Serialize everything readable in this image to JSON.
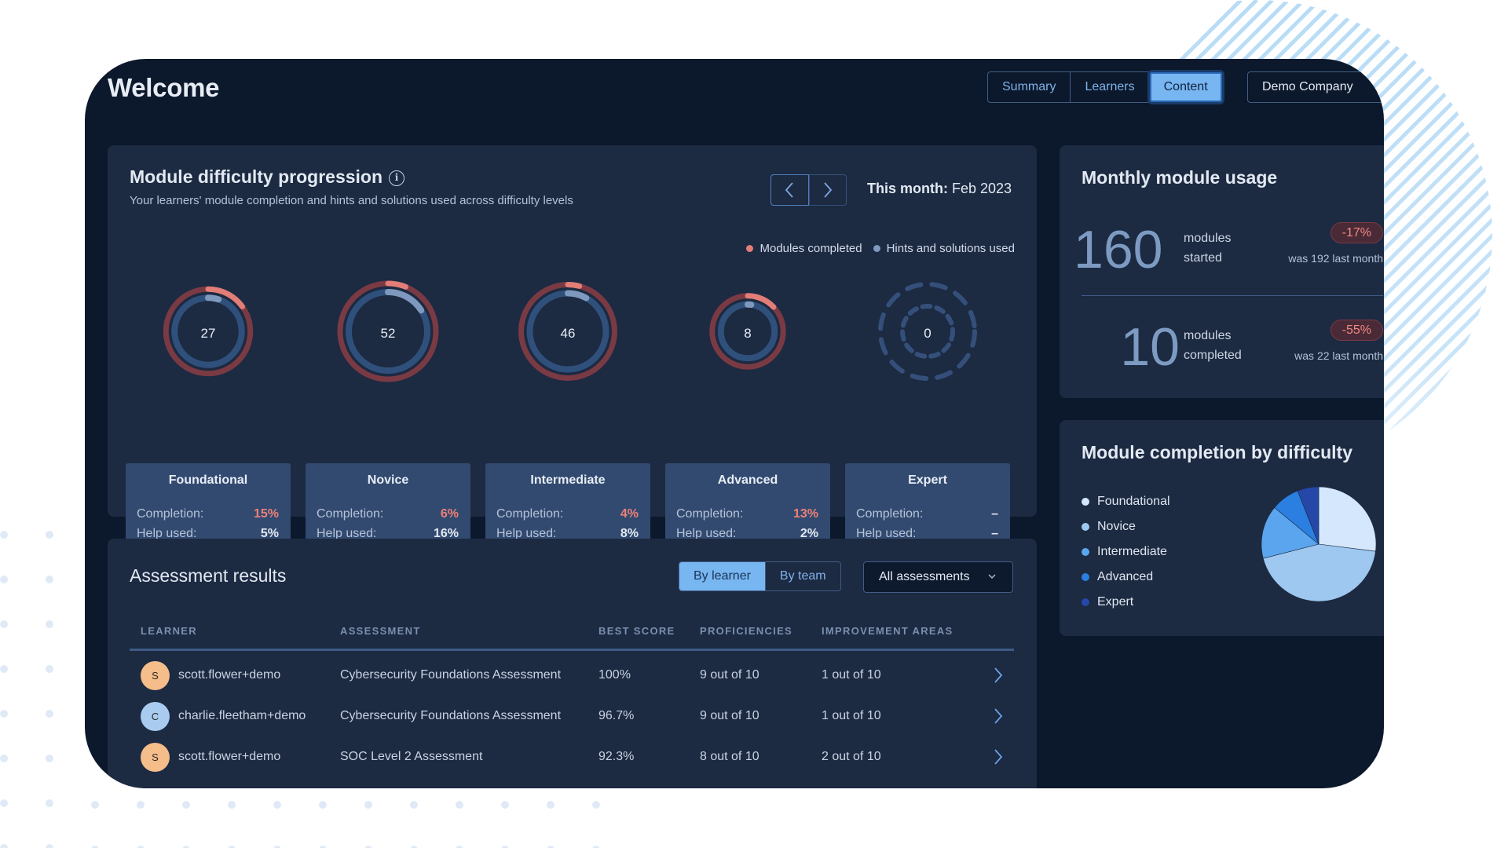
{
  "header": {
    "title": "Welcome",
    "tabs": [
      {
        "label": "Summary",
        "active": false
      },
      {
        "label": "Learners",
        "active": false
      },
      {
        "label": "Content",
        "active": true
      }
    ],
    "company_select": "Demo Company"
  },
  "difficulty_progression": {
    "title": "Module difficulty progression",
    "subtitle": "Your learners' module completion and hints and solutions used across difficulty levels",
    "month_label": "This month:",
    "month_value": "Feb 2023",
    "legend": [
      {
        "label": "Modules completed",
        "color": "#e27d78"
      },
      {
        "label": "Hints and solutions used",
        "color": "#7f98bd"
      }
    ],
    "levels": [
      {
        "name": "Foundational",
        "count": "27",
        "completion": "15%",
        "help_used": "5%",
        "completion_frac": 0.15,
        "help_frac": 0.05
      },
      {
        "name": "Novice",
        "count": "52",
        "completion": "6%",
        "help_used": "16%",
        "completion_frac": 0.06,
        "help_frac": 0.16
      },
      {
        "name": "Intermediate",
        "count": "46",
        "completion": "4%",
        "help_used": "8%",
        "completion_frac": 0.04,
        "help_frac": 0.08
      },
      {
        "name": "Advanced",
        "count": "8",
        "completion": "13%",
        "help_used": "2%",
        "completion_frac": 0.13,
        "help_frac": 0.02
      },
      {
        "name": "Expert",
        "count": "0",
        "completion": "–",
        "help_used": "–",
        "completion_frac": 0,
        "help_frac": 0
      }
    ],
    "completion_label": "Completion:",
    "help_label": "Help used:"
  },
  "monthly_usage": {
    "title": "Monthly module usage",
    "items": [
      {
        "value": "160",
        "label_line1": "modules",
        "label_line2": "started",
        "change": "-17%",
        "previous": "was 192 last month"
      },
      {
        "value": "10",
        "label_line1": "modules",
        "label_line2": "completed",
        "change": "-55%",
        "previous": "was 22 last month"
      }
    ]
  },
  "chart_data": {
    "type": "pie",
    "title": "Module completion by difficulty",
    "categories": [
      "Foundational",
      "Novice",
      "Intermediate",
      "Advanced",
      "Expert"
    ],
    "values": [
      27,
      44,
      15,
      8,
      6
    ],
    "colors": [
      "#d4e7fc",
      "#9ec8f0",
      "#5aa5ee",
      "#2a7fe0",
      "#2548a8"
    ],
    "legend_position": "left"
  },
  "assessment_results": {
    "title": "Assessment results",
    "view_toggle": [
      {
        "label": "By learner",
        "active": true
      },
      {
        "label": "By team",
        "active": false
      }
    ],
    "filter_select": "All assessments",
    "columns": [
      "LEARNER",
      "ASSESSMENT",
      "BEST SCORE",
      "PROFICIENCIES",
      "IMPROVEMENT AREAS"
    ],
    "rows": [
      {
        "initial": "S",
        "avatar_color": "#f5bd8a",
        "learner": "scott.flower+demo",
        "assessment": "Cybersecurity Foundations Assessment",
        "best_score": "100%",
        "proficiencies": "9 out of 10",
        "improvement": "1 out of 10"
      },
      {
        "initial": "C",
        "avatar_color": "#a9cbf0",
        "learner": "charlie.fleetham+demo",
        "assessment": "Cybersecurity Foundations Assessment",
        "best_score": "96.7%",
        "proficiencies": "9 out of 10",
        "improvement": "1 out of 10"
      },
      {
        "initial": "S",
        "avatar_color": "#f5bd8a",
        "learner": "scott.flower+demo",
        "assessment": "SOC Level 2 Assessment",
        "best_score": "92.3%",
        "proficiencies": "8 out of 10",
        "improvement": "2 out of 10"
      }
    ]
  }
}
